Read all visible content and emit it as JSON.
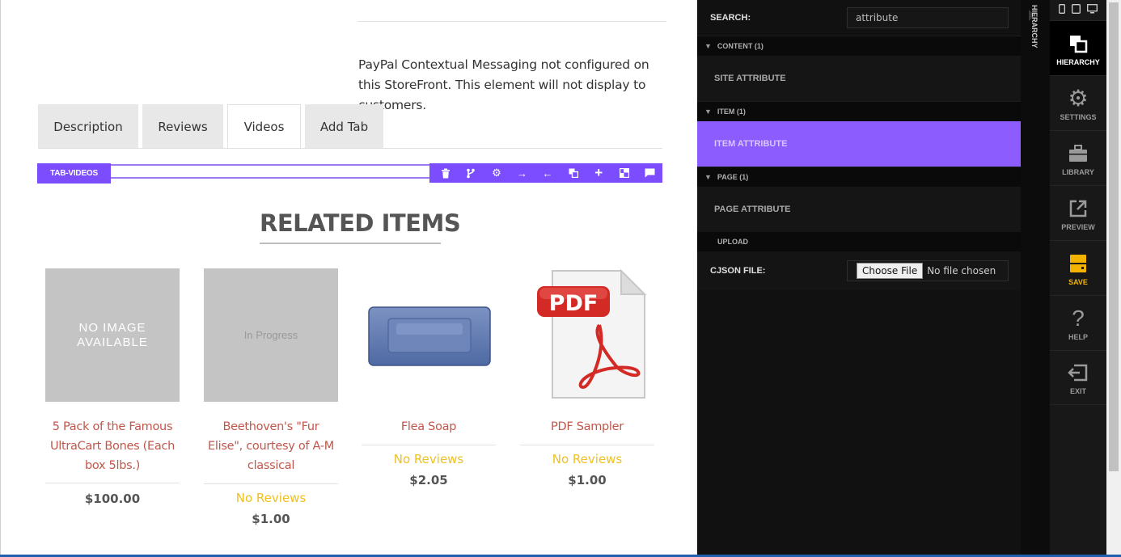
{
  "content": {
    "paypal_message": "PayPal Contextual Messaging not configured on this StoreFront. This element will not display to customers.",
    "tabs": [
      {
        "label": "Description",
        "active": false
      },
      {
        "label": "Reviews",
        "active": false
      },
      {
        "label": "Videos",
        "active": true
      },
      {
        "label": "Add Tab",
        "active": false
      }
    ],
    "selected_element_tag": "TAB-VIDEOS",
    "toolbar_icons": [
      "trash-icon",
      "branch-icon",
      "gear-icon",
      "arrow-right-icon",
      "arrow-left-icon",
      "duplicate-icon",
      "plus-icon",
      "layout-icon",
      "comment-icon"
    ],
    "related_title": "RELATED ITEMS",
    "products": [
      {
        "image_text": "NO IMAGE AVAILABLE",
        "name": "5 Pack of the Famous UltraCart Bones (Each box 5lbs.)",
        "reviews": "",
        "price": "$100.00"
      },
      {
        "image_text": "In Progress",
        "name": "Beethoven's \"Fur Elise\", courtesy of A-M classical",
        "reviews": "No Reviews",
        "price": "$1.00"
      },
      {
        "image_text": "",
        "name": "Flea Soap",
        "reviews": "No Reviews",
        "price": "$2.05"
      },
      {
        "image_text": "PDF",
        "name": "PDF Sampler",
        "reviews": "No Reviews",
        "price": "$1.00"
      }
    ]
  },
  "panel": {
    "search_label": "SEARCH:",
    "search_value": "attribute",
    "sections": [
      {
        "title": "CONTENT (1)",
        "item": "SITE ATTRIBUTE",
        "selected": false
      },
      {
        "title": "ITEM (1)",
        "item": "ITEM ATTRIBUTE",
        "selected": true
      },
      {
        "title": "PAGE (1)",
        "item": "PAGE ATTRIBUTE",
        "selected": false
      }
    ],
    "upload_label": "UPLOAD",
    "cjson_label": "CJSON FILE:",
    "choose_file_label": "Choose File",
    "no_file_text": "No file chosen"
  },
  "hierarchy_strip_label": "HIERARCHY",
  "nav": {
    "devices": [
      "phone-icon",
      "tablet-icon",
      "desktop-icon"
    ],
    "items": [
      {
        "label": "HIERARCHY",
        "icon": "hierarchy-icon",
        "active": true
      },
      {
        "label": "SETTINGS",
        "icon": "gear-icon"
      },
      {
        "label": "LIBRARY",
        "icon": "briefcase-icon"
      },
      {
        "label": "PREVIEW",
        "icon": "external-link-icon"
      },
      {
        "label": "SAVE",
        "icon": "save-icon",
        "accent": "#f2b400"
      },
      {
        "label": "HELP",
        "icon": "question-icon"
      },
      {
        "label": "EXIT",
        "icon": "exit-icon"
      }
    ]
  },
  "colors": {
    "accent_purple": "#7c4dff",
    "selected_row": "#8c5cff",
    "product_name": "#c0574c",
    "reviews": "#f0c020",
    "save": "#f2b400"
  }
}
